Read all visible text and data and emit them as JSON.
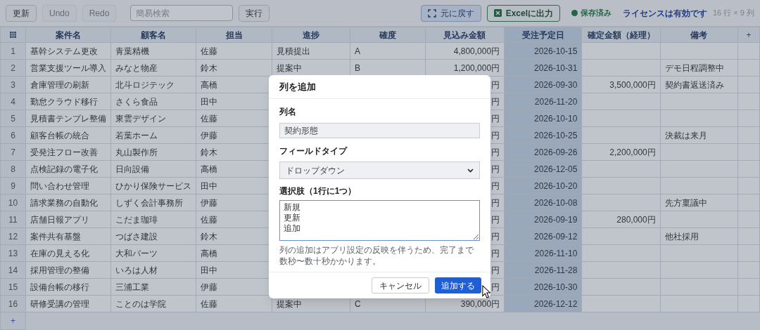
{
  "toolbar": {
    "buttons": [
      {
        "label": "更新",
        "disabled": false
      },
      {
        "label": "Undo",
        "disabled": true
      },
      {
        "label": "Redo",
        "disabled": true
      }
    ],
    "search": {
      "placeholder": "簡易検索"
    },
    "search_button": "実行",
    "restore_button": "元に戻す",
    "export_button": "Excelに出力",
    "save_status": "保存済み",
    "license_link": "ライセンスは有効です",
    "size_info": "16 行 × 9 列"
  },
  "table": {
    "columns": [
      {
        "label": "案件名",
        "selected": false
      },
      {
        "label": "顧客名",
        "selected": false
      },
      {
        "label": "担当",
        "selected": false
      },
      {
        "label": "進捗",
        "selected": false
      },
      {
        "label": "確度",
        "selected": false
      },
      {
        "label": "見込み金額",
        "selected": false
      },
      {
        "label": "受注予定日",
        "selected": true
      },
      {
        "label": "確定金額（経理）",
        "selected": false
      },
      {
        "label": "備考",
        "selected": false
      }
    ],
    "add_column": "+",
    "add_row": "+",
    "rows": [
      {
        "number": "1",
        "cells": [
          "基幹システム更改",
          "青葉精機",
          "佐藤",
          "見積提出",
          "A",
          "4,800,000円",
          "2026-10-15",
          "",
          ""
        ]
      },
      {
        "number": "2",
        "cells": [
          "営業支援ツール導入",
          "みなと物産",
          "鈴木",
          "提案中",
          "B",
          "1,200,000円",
          "2026-10-31",
          "",
          "デモ日程調整中"
        ]
      },
      {
        "number": "3",
        "cells": [
          "倉庫管理の刷新",
          "北斗ロジテック",
          "高橋",
          "",
          "",
          "円",
          "2026-09-30",
          "3,500,000円",
          "契約書返送済み"
        ]
      },
      {
        "number": "4",
        "cells": [
          "勤怠クラウド移行",
          "さくら食品",
          "田中",
          "",
          "",
          "円",
          "2026-11-20",
          "",
          ""
        ]
      },
      {
        "number": "5",
        "cells": [
          "見積書テンプレ整備",
          "東雲デザイン",
          "佐藤",
          "",
          "",
          "円",
          "2026-10-10",
          "",
          ""
        ]
      },
      {
        "number": "6",
        "cells": [
          "顧客台帳の統合",
          "若葉ホーム",
          "伊藤",
          "",
          "",
          "円",
          "2026-10-25",
          "",
          "決裁は来月"
        ]
      },
      {
        "number": "7",
        "cells": [
          "受発注フロー改善",
          "丸山製作所",
          "鈴木",
          "",
          "",
          "円",
          "2026-09-26",
          "2,200,000円",
          ""
        ]
      },
      {
        "number": "8",
        "cells": [
          "点検記録の電子化",
          "日向設備",
          "高橋",
          "",
          "",
          "円",
          "2026-12-05",
          "",
          ""
        ]
      },
      {
        "number": "9",
        "cells": [
          "問い合わせ管理",
          "ひかり保険サービス",
          "田中",
          "",
          "",
          "円",
          "2026-10-20",
          "",
          ""
        ]
      },
      {
        "number": "10",
        "cells": [
          "請求業務の自動化",
          "しずく会計事務所",
          "伊藤",
          "",
          "",
          "円",
          "2026-10-08",
          "",
          "先方稟議中"
        ]
      },
      {
        "number": "11",
        "cells": [
          "店舗日報アプリ",
          "こだま珈琲",
          "佐藤",
          "",
          "",
          "円",
          "2026-09-19",
          "280,000円",
          ""
        ]
      },
      {
        "number": "12",
        "cells": [
          "案件共有基盤",
          "つばさ建設",
          "鈴木",
          "",
          "",
          "円",
          "2026-09-12",
          "",
          "他社採用"
        ]
      },
      {
        "number": "13",
        "cells": [
          "在庫の見える化",
          "大和パーツ",
          "高橋",
          "",
          "",
          "円",
          "2026-11-10",
          "",
          ""
        ]
      },
      {
        "number": "14",
        "cells": [
          "採用管理の整備",
          "いろは人材",
          "田中",
          "",
          "",
          "円",
          "2026-11-28",
          "",
          ""
        ]
      },
      {
        "number": "15",
        "cells": [
          "設備台帳の移行",
          "三浦工業",
          "伊藤",
          "",
          "",
          "円",
          "2026-10-30",
          "",
          ""
        ]
      },
      {
        "number": "16",
        "cells": [
          "研修受講の管理",
          "ことのは学院",
          "佐藤",
          "提案中",
          "C",
          "390,000円",
          "2026-12-12",
          "",
          ""
        ]
      }
    ]
  },
  "dialog": {
    "title": "列を追加",
    "name_label": "列名",
    "name_value": "契約形態",
    "type_label": "フィールドタイプ",
    "type_value": "ドロップダウン",
    "options_label": "選択肢（1行に1つ）",
    "options_lines": [
      "新規",
      "更新",
      "追加"
    ],
    "note": "列の追加はアプリ設定の反映を伴うため、完了まで数秒〜数十秒かかります。",
    "cancel_button": "キャンセル",
    "submit_button": "追加する"
  }
}
